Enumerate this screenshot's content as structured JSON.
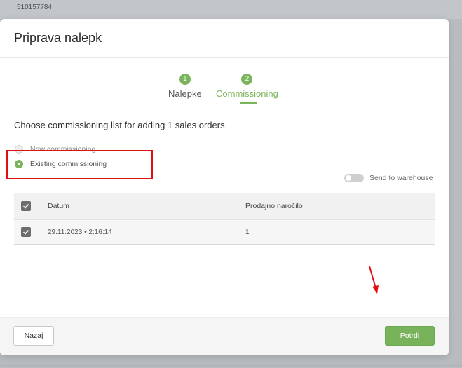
{
  "background": {
    "order_id": "510157784"
  },
  "modal": {
    "title": "Priprava nalepk",
    "steps": [
      {
        "number": "1",
        "label": "Nalepke",
        "active": false
      },
      {
        "number": "2",
        "label": "Commissioning",
        "active": true
      }
    ],
    "section_title": "Choose commissioning list for adding 1 sales orders",
    "options": [
      {
        "label": "New commissioning",
        "checked": false
      },
      {
        "label": "Existing commissioning",
        "checked": true
      }
    ],
    "send_to_warehouse": {
      "label": "Send to warehouse",
      "enabled": false
    },
    "table": {
      "columns": [
        "Datum",
        "Prodajno naročilo"
      ],
      "rows": [
        {
          "date": "29.11.2023 • 2:16:14",
          "sales_order": "1",
          "checked": true
        }
      ]
    },
    "footer": {
      "back_label": "Nazaj",
      "confirm_label": "Potrdi"
    }
  },
  "colors": {
    "accent": "#7ab55c",
    "annotation": "#e01010"
  }
}
